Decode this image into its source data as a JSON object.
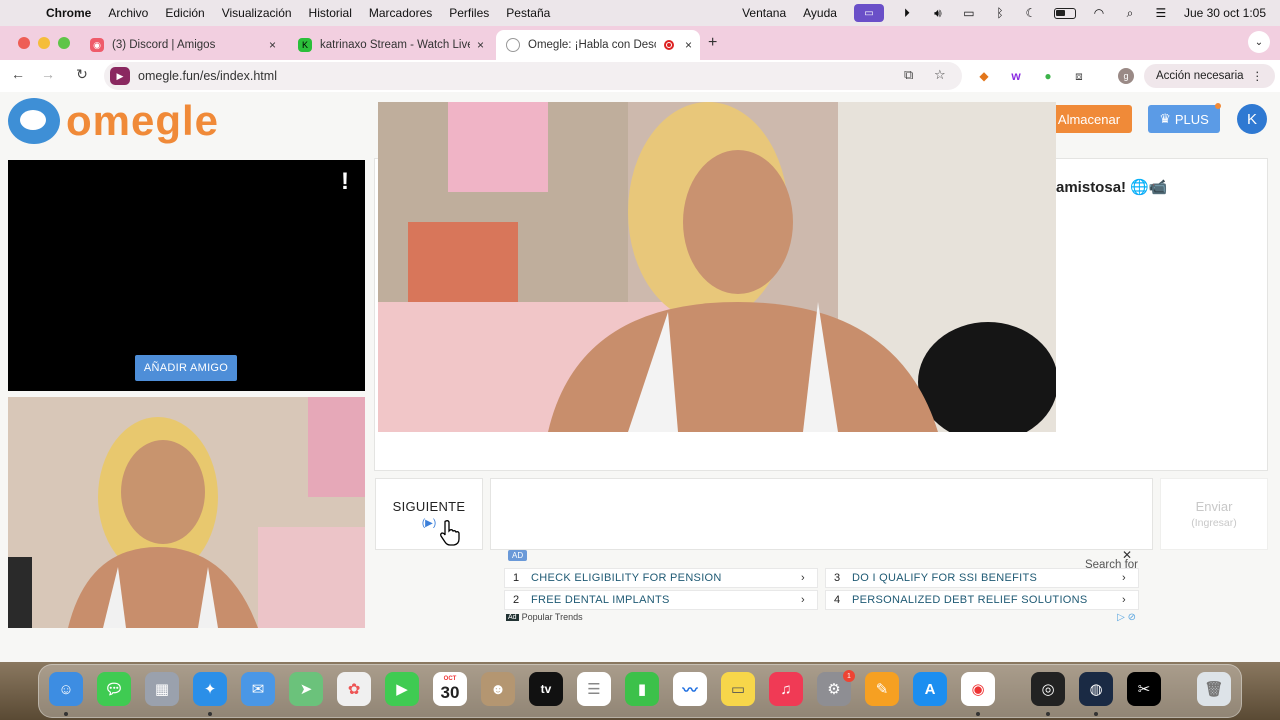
{
  "menubar": {
    "app": "Chrome",
    "items": [
      "Archivo",
      "Edición",
      "Visualización",
      "Historial",
      "Marcadores",
      "Perfiles",
      "Pestaña"
    ],
    "right_items": [
      "Ventana",
      "Ayuda"
    ],
    "clock": "Jue 30 oct 1:05"
  },
  "tabs": [
    {
      "title": "(3) Discord | Amigos",
      "close": "×"
    },
    {
      "title": "katrinaxo Stream - Watch Live",
      "close": "×"
    },
    {
      "title": "Omegle: ¡Habla con Desconocidos!",
      "close": "×"
    }
  ],
  "newtab": "+",
  "toolbar": {
    "url": "omegle.fun/es/index.html",
    "profile_initial": "g",
    "action_label": "Acción necesaria"
  },
  "page": {
    "logo_text": "omegle",
    "store_label": "Almacenar",
    "plus_label": "PLUS",
    "user_initial": "K",
    "stranger_alert": "!",
    "add_friend_label": "AÑADIR AMIGO",
    "chat_message": "amistosa! 🌐📹",
    "next_label": "SIGUIENTE",
    "send_label": "Enviar",
    "send_hint": "(Ingresar)"
  },
  "ad": {
    "badge": "AD",
    "search_for": "Search for",
    "items": [
      {
        "num": "1",
        "text": "Check eligibility for pension"
      },
      {
        "num": "2",
        "text": "Free Dental Implants"
      },
      {
        "num": "3",
        "text": "Do I qualify for SSI benefits"
      },
      {
        "num": "4",
        "text": "Personalized debt relief solutions"
      }
    ],
    "footer": "Popular Trends"
  },
  "dock": {
    "calendar_month": "OCT",
    "calendar_day": "30",
    "tv_label": "tv",
    "settings_badge": "1"
  },
  "colors": {
    "tabstrip": "#f2cfe0",
    "omegle_orange": "#f08a38",
    "omegle_blue": "#3e8fd6",
    "plus_blue": "#5b9be6"
  }
}
